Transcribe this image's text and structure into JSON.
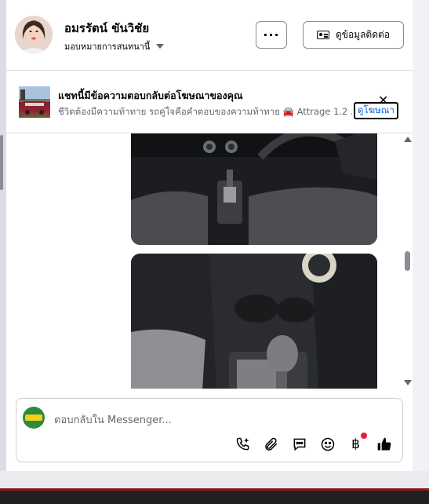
{
  "header": {
    "page_name": "อมรรัตน์ ขันวิชัย",
    "assign_label": "มอบหมายการสนทนานี้",
    "more_label": "···",
    "contact_label": "ดูข้อมูลติดต่อ"
  },
  "ad_bar": {
    "title": "แชทนี้มีข้อความตอบกลับต่อโฆษณาของคุณ",
    "description": "ชีวิตต้องมีความท้าทาย รถคู่ใจคือคำตอบของความท้าทาย 🚘 Attrage 1.2 ...",
    "view_ad_label": "ดูโฆษณา",
    "close_label": "✕"
  },
  "composer": {
    "placeholder": "ตอบกลับใน Messenger...",
    "tools": [
      "add-call-icon",
      "attachment-icon",
      "saved-reply-icon",
      "emoji-icon",
      "baht-payment-icon",
      "like-icon"
    ],
    "baht_symbol": "฿"
  },
  "colors": {
    "accent": "#0064d1",
    "notification": "#e41e3f",
    "panel_bg": "#ffffff",
    "page_bg": "#e9ebee"
  }
}
